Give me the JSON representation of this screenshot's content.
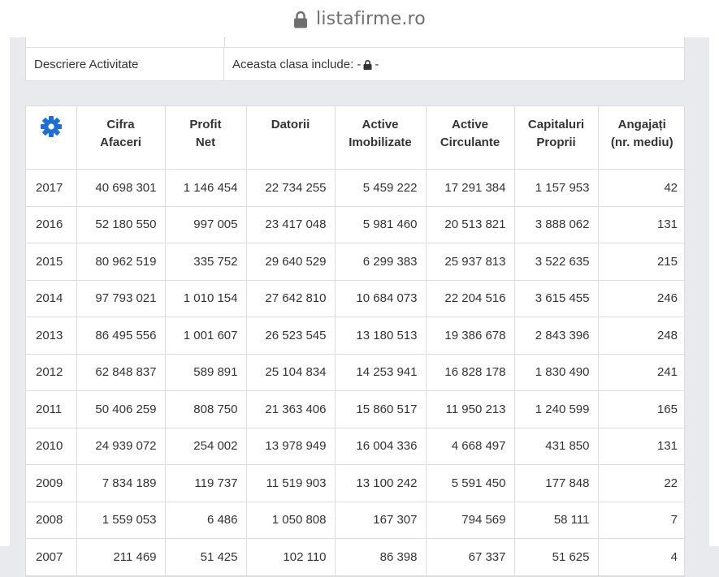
{
  "browser": {
    "domain": "listafirme.ro",
    "lock_icon": "lock-icon"
  },
  "info": {
    "label": "Descriere Activitate",
    "value_prefix": "Aceasta clasa include: -",
    "value_suffix": "-"
  },
  "table": {
    "settings_icon": "gear-icon",
    "settings_color": "#1f6fd1",
    "headers": [
      [
        "Cifra",
        "Afaceri"
      ],
      [
        "Profit",
        "Net"
      ],
      [
        "Datorii",
        ""
      ],
      [
        "Active",
        "Imobilizate"
      ],
      [
        "Active",
        "Circulante"
      ],
      [
        "Capitaluri",
        "Proprii"
      ],
      [
        "Angajați",
        "(nr. mediu)"
      ]
    ],
    "rows": [
      [
        "2017",
        "40 698 301",
        "1 146 454",
        "22 734 255",
        "5 459 222",
        "17 291 384",
        "1 157 953",
        "42"
      ],
      [
        "2016",
        "52 180 550",
        "997 005",
        "23 417 048",
        "5 981 460",
        "20 513 821",
        "3 888 062",
        "131"
      ],
      [
        "2015",
        "80 962 519",
        "335 752",
        "29 640 529",
        "6 299 383",
        "25 937 813",
        "3 522 635",
        "215"
      ],
      [
        "2014",
        "97 793 021",
        "1 010 154",
        "27 642 810",
        "10 684 073",
        "22 204 516",
        "3 615 455",
        "246"
      ],
      [
        "2013",
        "86 495 556",
        "1 001 607",
        "26 523 545",
        "13 180 513",
        "19 386 678",
        "2 843 396",
        "248"
      ],
      [
        "2012",
        "62 848 837",
        "589 891",
        "25 104 834",
        "14 253 941",
        "16 828 178",
        "1 830 490",
        "241"
      ],
      [
        "2011",
        "50 406 259",
        "808 750",
        "21 363 406",
        "15 860 517",
        "11 950 213",
        "1 240 599",
        "165"
      ],
      [
        "2010",
        "24 939 072",
        "254 002",
        "13 978 949",
        "16 004 336",
        "4 668 497",
        "431 850",
        "131"
      ],
      [
        "2009",
        "7 834 189",
        "119 737",
        "11 519 903",
        "13 100 242",
        "5 591 450",
        "177 848",
        "22"
      ],
      [
        "2008",
        "1 559 053",
        "6 486",
        "1 050 808",
        "167 307",
        "794 569",
        "58 111",
        "7"
      ],
      [
        "2007",
        "211 469",
        "51 425",
        "102 110",
        "86 398",
        "67 337",
        "51 625",
        "4"
      ]
    ]
  }
}
